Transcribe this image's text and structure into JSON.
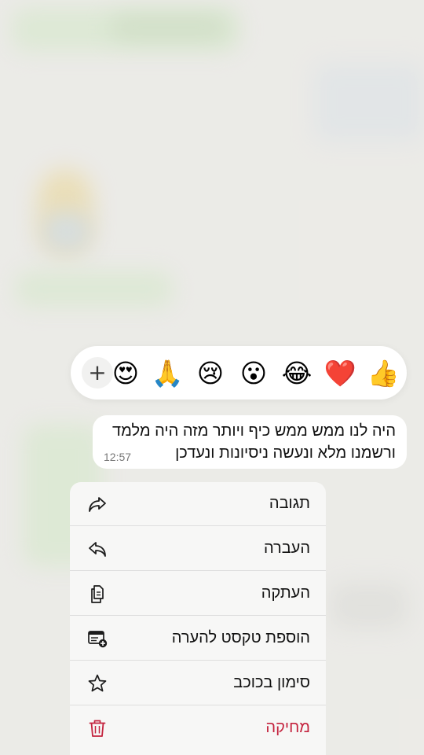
{
  "reactions": {
    "emojis": [
      "👍",
      "❤️",
      "😂",
      "😮",
      "😢",
      "🙏",
      "😍"
    ],
    "add_label": "+"
  },
  "message": {
    "line1": "היה לנו ממש ממש כיף ויותר מזה היה מלמד",
    "line2": "ורשמנו מלא ונעשה ניסיונות ונעדכן",
    "time": "12:57"
  },
  "menu": {
    "items": [
      {
        "label": "תגובה",
        "icon": "reply-icon"
      },
      {
        "label": "העברה",
        "icon": "forward-icon"
      },
      {
        "label": "העתקה",
        "icon": "copy-icon"
      },
      {
        "label": "הוספת טקסט להערה",
        "icon": "add-note-icon"
      },
      {
        "label": "סימון בכוכב",
        "icon": "star-icon"
      },
      {
        "label": "מחיקה",
        "icon": "trash-icon"
      }
    ]
  },
  "colors": {
    "delete": "#c4233e",
    "icon": "#1c1c1c"
  }
}
